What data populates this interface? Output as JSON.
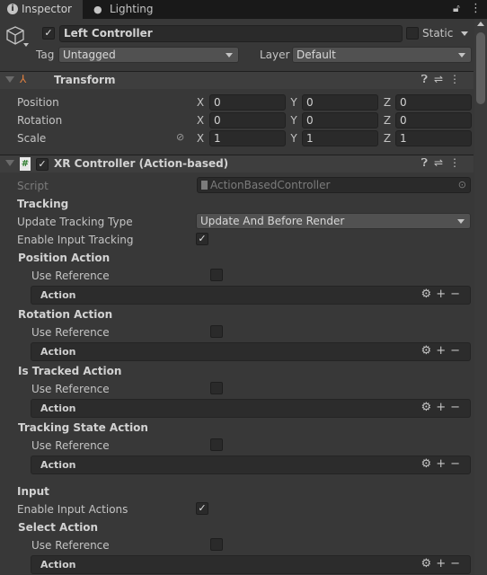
{
  "tabs": [
    {
      "label": "Inspector",
      "icon": "info-icon"
    },
    {
      "label": "Lighting",
      "icon": "lightbulb-icon"
    }
  ],
  "object": {
    "name": "Left Controller",
    "active": true,
    "static_label": "Static",
    "static": false,
    "tag_label": "Tag",
    "tag": "Untagged",
    "layer_label": "Layer",
    "layer": "Default"
  },
  "transform": {
    "title": "Transform",
    "rows": [
      {
        "label": "Position",
        "x": "0",
        "y": "0",
        "z": "0"
      },
      {
        "label": "Rotation",
        "x": "0",
        "y": "0",
        "z": "0"
      },
      {
        "label": "Scale",
        "x": "1",
        "y": "1",
        "z": "1"
      }
    ],
    "axes": [
      "X",
      "Y",
      "Z"
    ]
  },
  "xr": {
    "title": "XR Controller (Action-based)",
    "enabled": true,
    "script_label": "Script",
    "script": "ActionBasedController",
    "tracking_header": "Tracking",
    "update_tracking_label": "Update Tracking Type",
    "update_tracking": "Update And Before Render",
    "enable_input_tracking_label": "Enable Input Tracking",
    "enable_input_tracking": true,
    "input_header": "Input",
    "enable_input_actions_label": "Enable Input Actions",
    "enable_input_actions": true,
    "use_reference_label": "Use Reference",
    "action_label": "Action",
    "actions": [
      "Position Action",
      "Rotation Action",
      "Is Tracked Action",
      "Tracking State Action",
      "Select Action"
    ]
  }
}
